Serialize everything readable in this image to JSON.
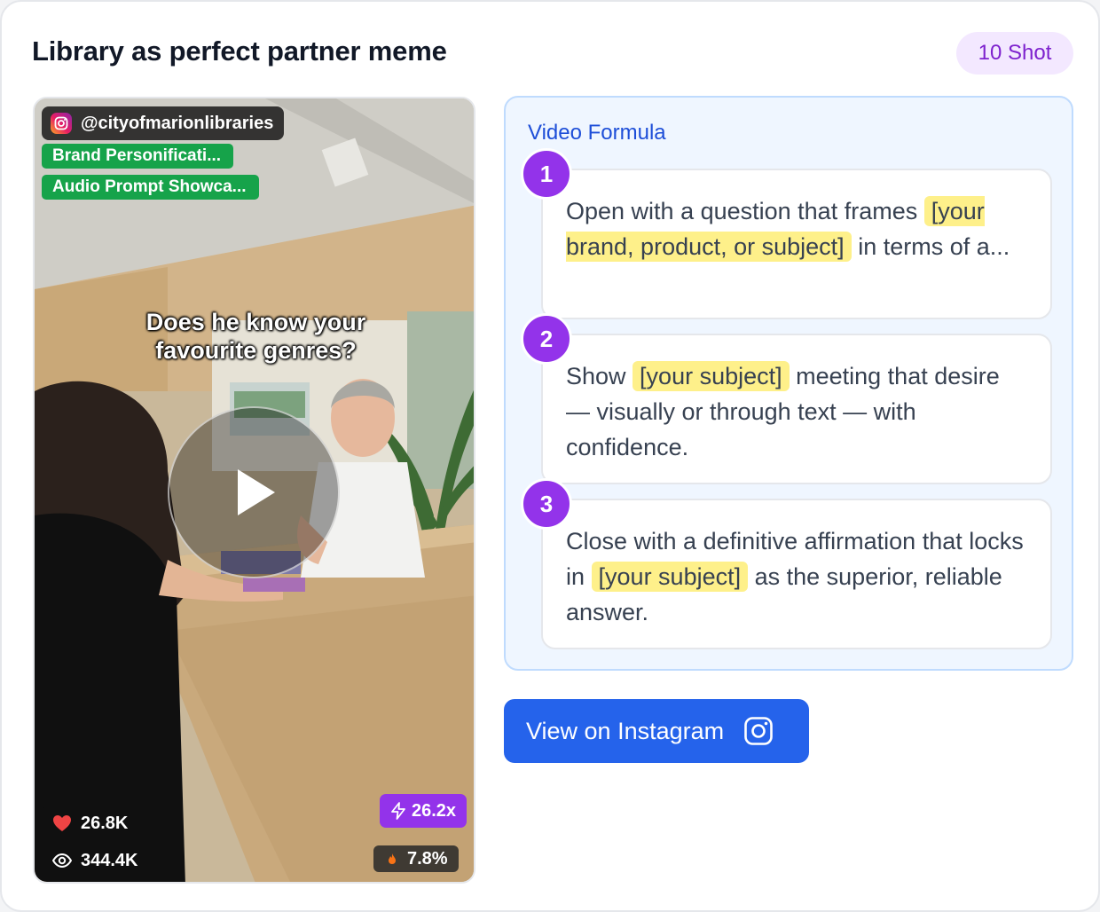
{
  "header": {
    "title": "Library as perfect partner meme",
    "shot_badge": "10 Shot"
  },
  "video": {
    "handle": "@cityofmarionlibraries",
    "tags": [
      "Brand Personificati...",
      "Audio Prompt Showca..."
    ],
    "caption_line1": "Does he know your",
    "caption_line2": "favourite genres?",
    "likes": "26.8K",
    "views": "344.4K",
    "multiplier": "26.2x",
    "engagement": "7.8%"
  },
  "formula": {
    "heading": "Video Formula",
    "steps": [
      {
        "number": "1",
        "t1": "Open with a question that frames ",
        "hl": "[your brand, product, or subject]",
        "t2": " in terms of a..."
      },
      {
        "number": "2",
        "t1": "Show ",
        "hl": "[your subject]",
        "t2": " meeting that desire — visually or through text — with confidence."
      },
      {
        "number": "3",
        "t1": "Close with a definitive affirmation that locks in ",
        "hl": "[your subject]",
        "t2": " as the superior, reliable answer."
      }
    ]
  },
  "actions": {
    "instagram_button": "View on Instagram"
  },
  "colors": {
    "accent_blue": "#2563eb",
    "step_purple": "#9333ea",
    "tag_green": "#16a34a",
    "highlight_yellow": "#fef08a",
    "badge_bg": "#f3e8ff"
  },
  "icons": [
    "instagram-icon",
    "heart-icon",
    "eye-icon",
    "bolt-icon",
    "flame-icon",
    "play-icon"
  ]
}
